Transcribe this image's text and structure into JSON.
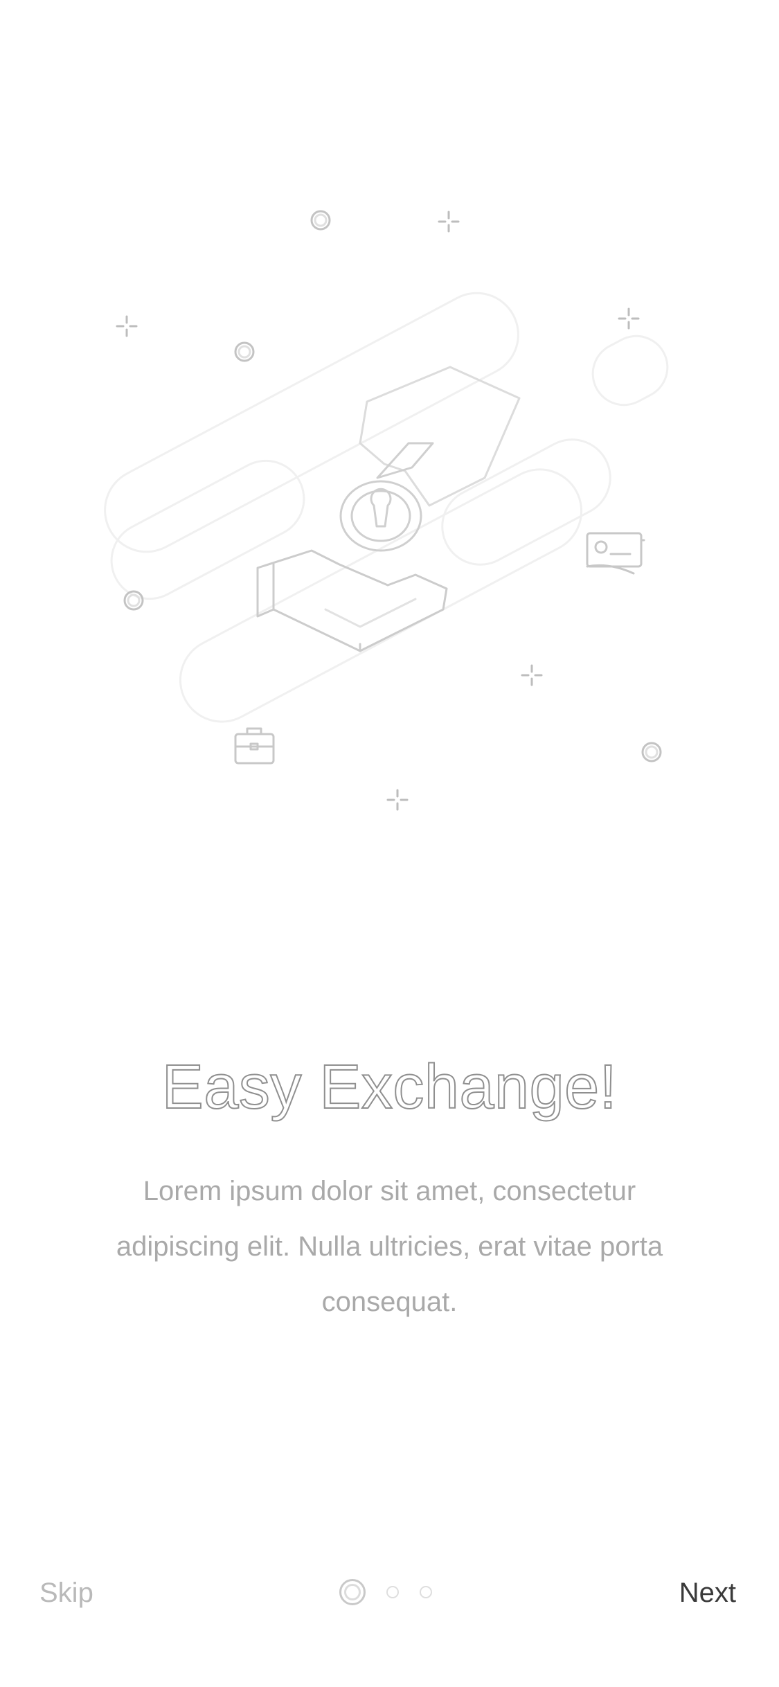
{
  "onboarding": {
    "title": "Easy Exchange!",
    "description": "Lorem ipsum dolor sit amet, consectetur adipiscing elit. Nulla ultricies, erat vitae porta consequat.",
    "illustration": "hand-dropping-coin-illustration"
  },
  "footer": {
    "skip_label": "Skip",
    "next_label": "Next",
    "pager": {
      "total_pages": 3,
      "current_page": 1
    }
  },
  "colors": {
    "background": "#ffffff",
    "title_stroke": "#8f8f8f",
    "body_text": "#a9a9a9",
    "skip_text": "#b9b9b9",
    "next_text": "#3a3a3a",
    "line_art": "#d6d6d6"
  }
}
